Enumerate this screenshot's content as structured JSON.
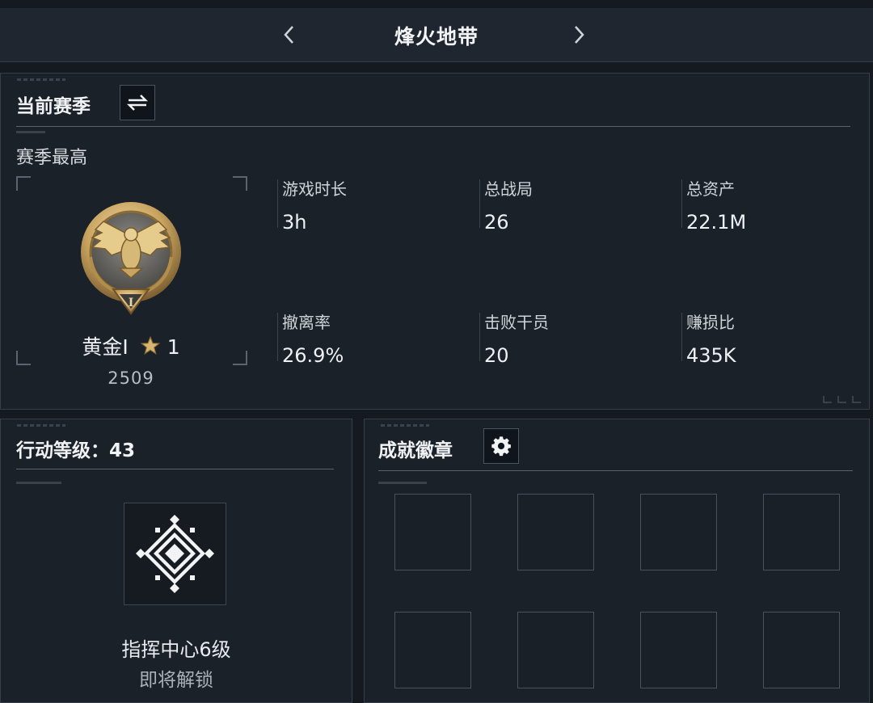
{
  "header": {
    "title": "烽火地带",
    "prev_icon": "chevron-left-icon",
    "next_icon": "chevron-right-icon"
  },
  "season": {
    "title": "当前赛季",
    "switch_icon": "switch-arrows-icon",
    "subtitle": "赛季最高",
    "rank": {
      "emblem_icon": "gold-eagle-emblem",
      "emblem_numeral": "I",
      "name": "黄金I",
      "star_icon": "star-icon",
      "stars": "1",
      "score": "2509"
    },
    "stats": [
      {
        "label": "游戏时长",
        "value": "3h"
      },
      {
        "label": "总战局",
        "value": "26"
      },
      {
        "label": "总资产",
        "value": "22.1M"
      },
      {
        "label": "撤离率",
        "value": "26.9%"
      },
      {
        "label": "击败干员",
        "value": "20"
      },
      {
        "label": "赚损比",
        "value": "435K"
      }
    ]
  },
  "action_level": {
    "title": "行动等级：43",
    "emblem_icon": "command-center-emblem",
    "unlock_title": "指挥中心6级",
    "unlock_sub": "即将解锁"
  },
  "achievements": {
    "title": "成就徽章",
    "settings_icon": "gear-icon",
    "slot_count": 8
  },
  "colors": {
    "background": "#151a21",
    "panel": "#1b2129",
    "gold": "#c9a460"
  }
}
